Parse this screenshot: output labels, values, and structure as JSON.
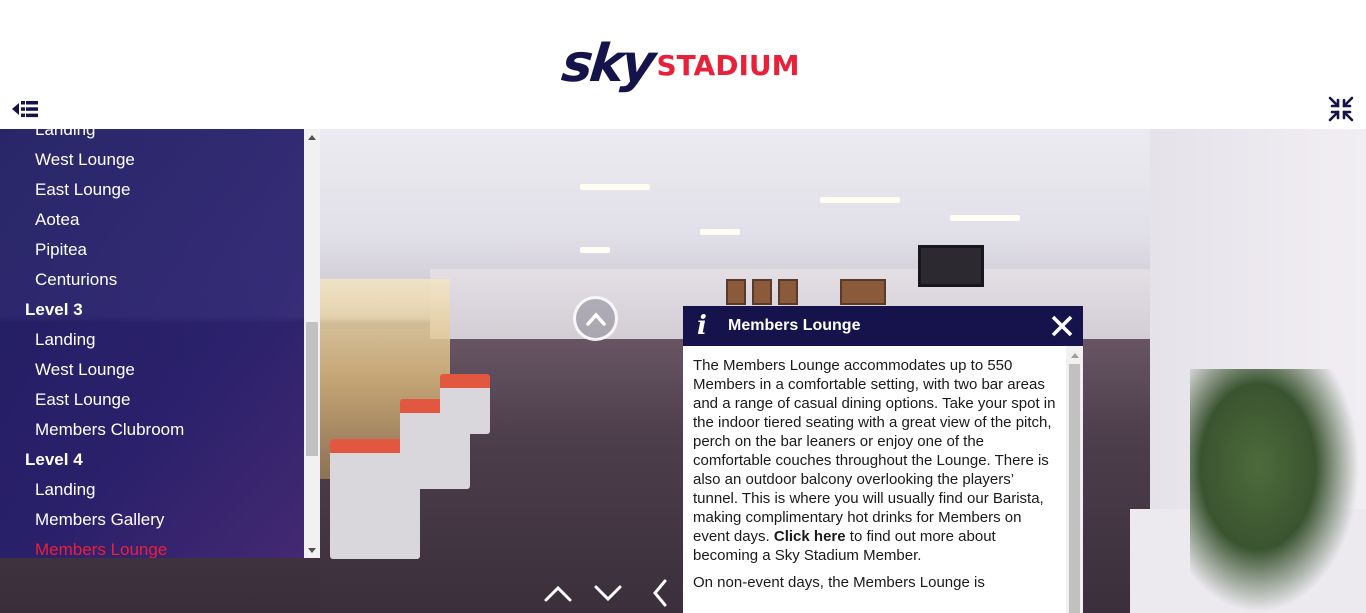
{
  "header": {
    "logo_sky": "sky",
    "logo_stadium": "STADIUM",
    "logo_colors": {
      "sky": "#14134a",
      "stadium": "#e8213b"
    },
    "menu_toggle_icon": "menu-collapse-icon",
    "fullscreen_icon": "exit-fullscreen-icon"
  },
  "sidebar": {
    "items": [
      {
        "label": "Landing",
        "type": "sub"
      },
      {
        "label": "West Lounge",
        "type": "sub"
      },
      {
        "label": "East Lounge",
        "type": "sub"
      },
      {
        "label": "Aotea",
        "type": "sub"
      },
      {
        "label": "Pipitea",
        "type": "sub"
      },
      {
        "label": "Centurions",
        "type": "sub"
      },
      {
        "label": "Level 3",
        "type": "group"
      },
      {
        "label": "Landing",
        "type": "sub"
      },
      {
        "label": "West Lounge",
        "type": "sub"
      },
      {
        "label": "East Lounge",
        "type": "sub"
      },
      {
        "label": "Members Clubroom",
        "type": "sub"
      },
      {
        "label": "Level 4",
        "type": "group"
      },
      {
        "label": "Landing",
        "type": "sub"
      },
      {
        "label": "Members Gallery",
        "type": "sub"
      },
      {
        "label": "Members Lounge",
        "type": "sub",
        "active": true
      }
    ],
    "active_color": "#e8213b"
  },
  "info_panel": {
    "icon": "i",
    "title": "Members Lounge",
    "paragraph1_before_link": "The Members Lounge accommodates up to 550 Members in a comfortable setting, with two bar areas and a range of casual dining options. Take your spot in the indoor tiered seating with a great view of the pitch, perch on the bar leaners or enjoy one of the comfortable couches throughout the Lounge. There is also an outdoor balcony overlooking the players’ tunnel. This is where you will usually find our Barista, making complimentary hot drinks for Members on event days.",
    "link_text": "Click here",
    "paragraph1_after_link": "to find out more about becoming a Sky Stadium Member.",
    "paragraph2": "On non-event days, the Members Lounge is",
    "header_color": "#15124c"
  },
  "navigation": {
    "up_icon": "chevron-up-icon",
    "down_icon": "chevron-down-icon",
    "back_icon": "chevron-left-icon",
    "hotspot_icon": "hotspot-up-arrow-icon"
  }
}
